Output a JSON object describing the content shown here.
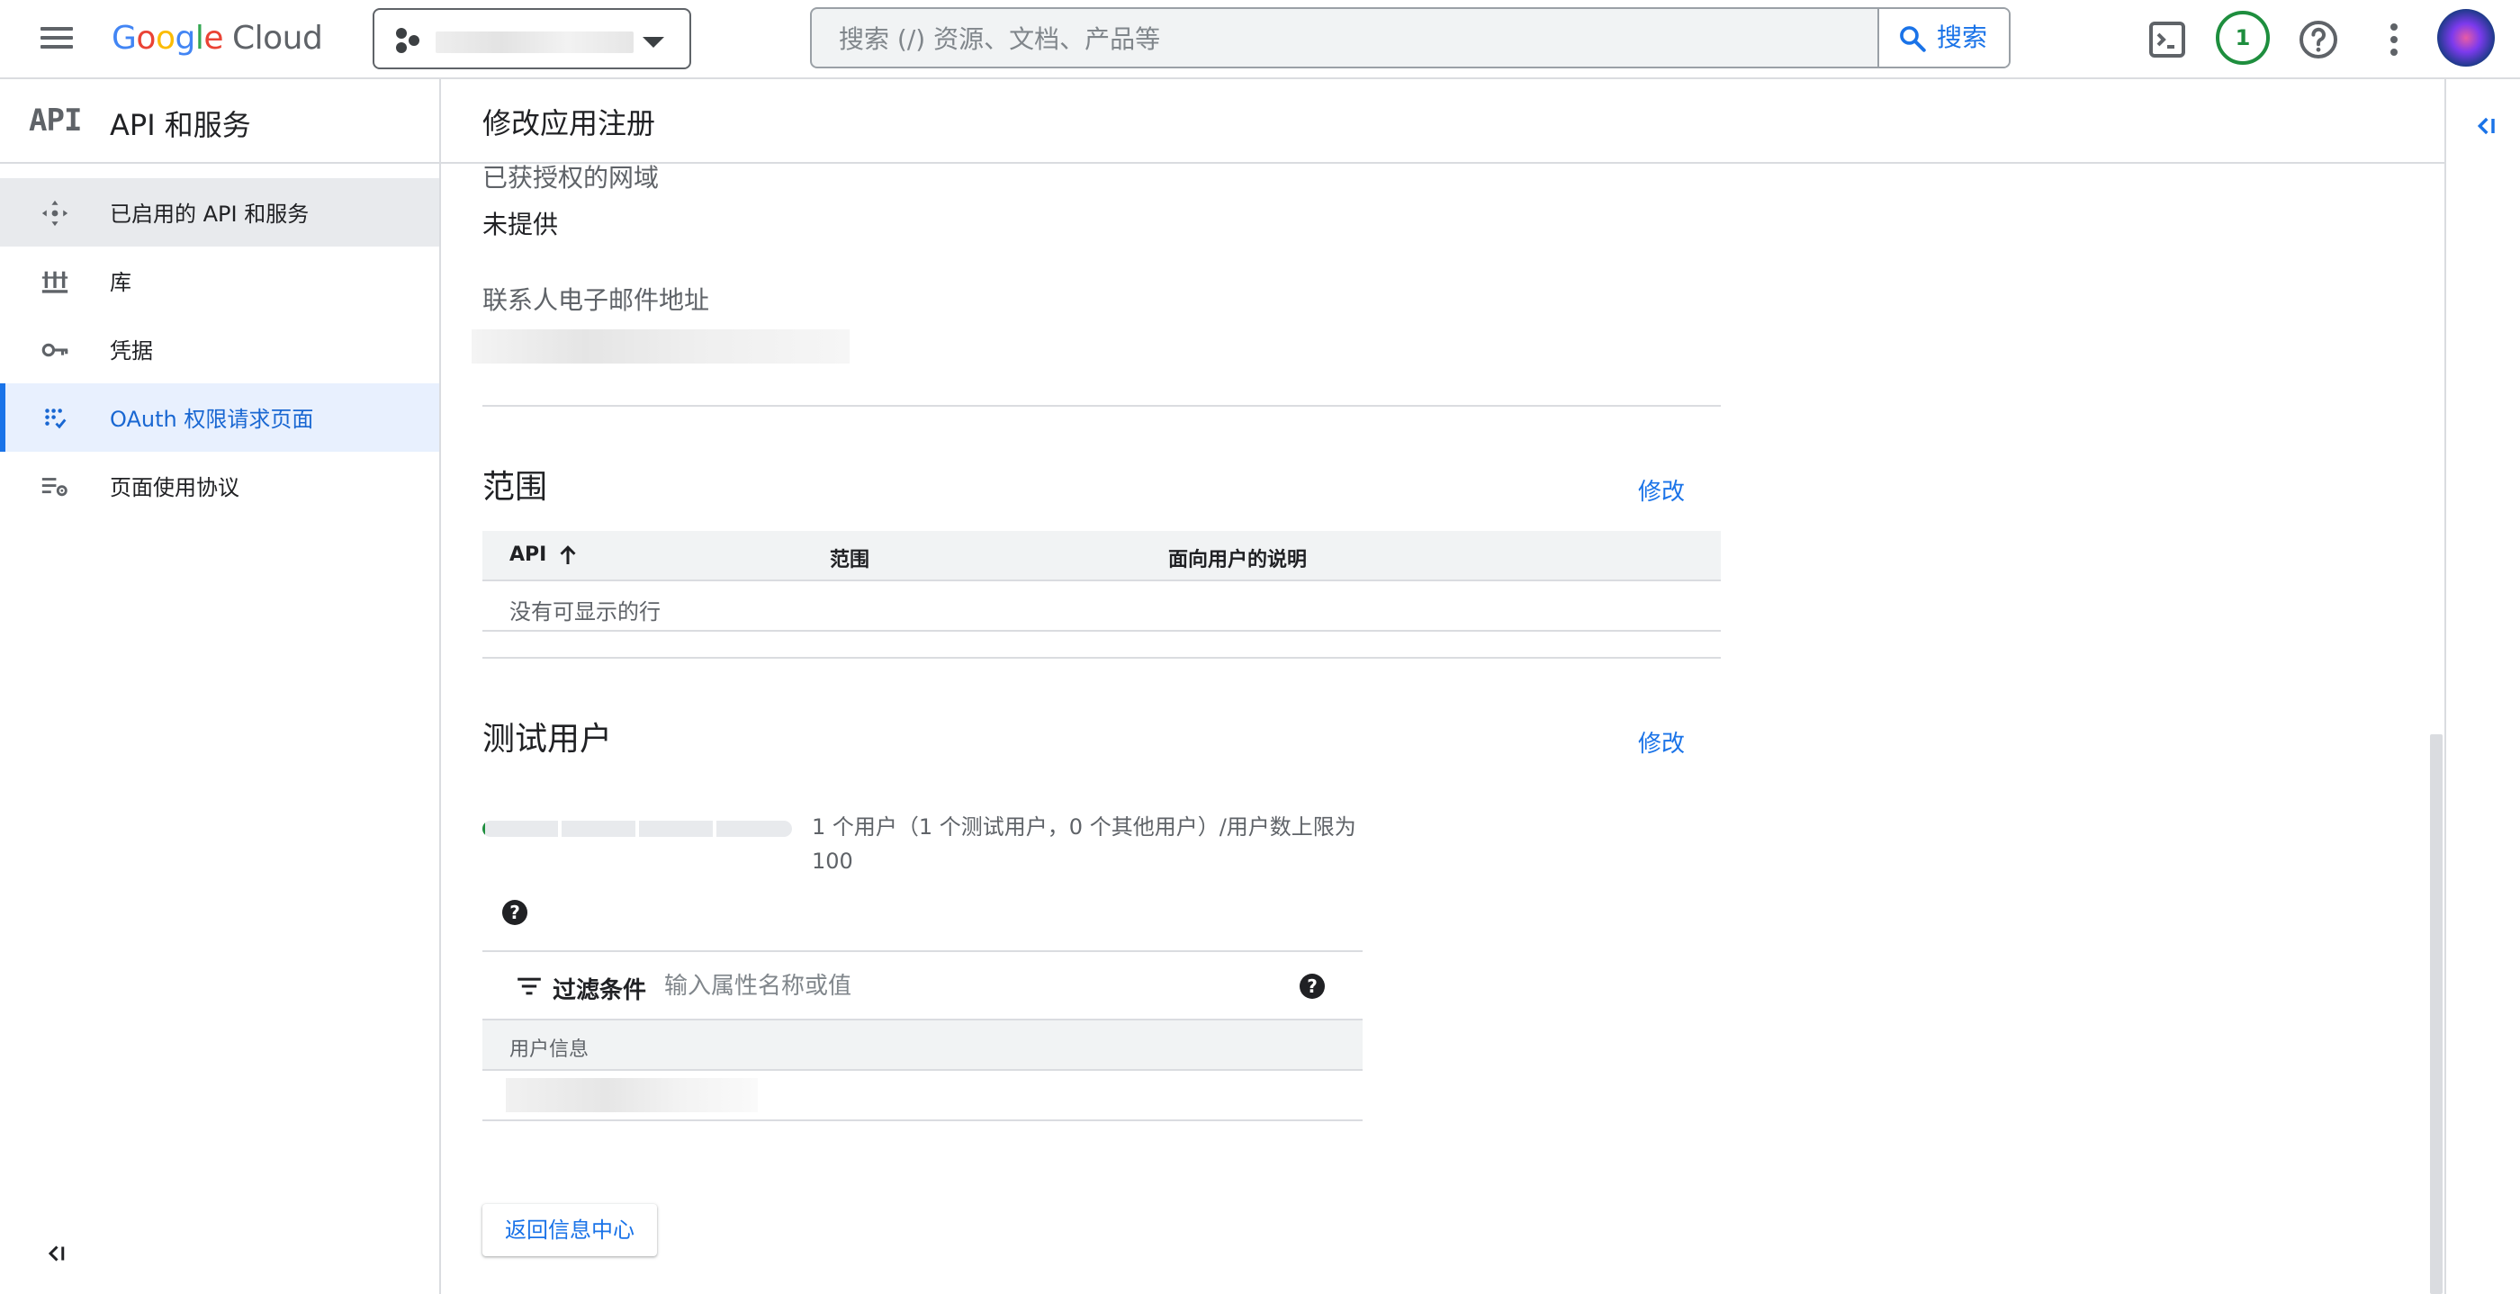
{
  "topbar": {
    "logo_google": [
      "G",
      "o",
      "o",
      "g",
      "l",
      "e"
    ],
    "logo_cloud": "Cloud",
    "search_placeholder": "搜索 (/) 资源、文档、产品等",
    "search_button": "搜索",
    "notification_count": "1",
    "icons": [
      "menu-icon",
      "cloud-shell-icon",
      "help-icon",
      "more-vert-icon"
    ]
  },
  "sidebar": {
    "badge": "API",
    "title": "API 和服务",
    "items": [
      {
        "label": "已启用的 API 和服务",
        "icon": "enabled-apis-icon"
      },
      {
        "label": "库",
        "icon": "library-icon"
      },
      {
        "label": "凭据",
        "icon": "key-icon"
      },
      {
        "label": "OAuth 权限请求页面",
        "icon": "oauth-icon"
      },
      {
        "label": "页面使用协议",
        "icon": "page-usage-icon"
      }
    ]
  },
  "main": {
    "page_title": "修改应用注册",
    "authorized_domains_label": "已获授权的网域",
    "authorized_domains_value": "未提供",
    "contact_email_label": "联系人电子邮件地址",
    "scopes": {
      "title": "范围",
      "edit": "修改",
      "columns": [
        "API",
        "范围",
        "面向用户的说明"
      ],
      "empty_row": "没有可显示的行"
    },
    "test_users": {
      "title": "测试用户",
      "edit": "修改",
      "quota_text": "1 个用户（1 个测试用户，0 个其他用户）/用户数上限为 100",
      "quota_fraction": 0.01,
      "filter_label": "过滤条件",
      "filter_placeholder": "输入属性名称或值",
      "column": "用户信息",
      "help_glyph": "?"
    },
    "back_button": "返回信息中心"
  },
  "colors": {
    "accent": "#1a73e8",
    "active_bg": "#e8f0fe",
    "enabled_bg": "#e8eaed",
    "badge_green": "#1e8e3e"
  }
}
